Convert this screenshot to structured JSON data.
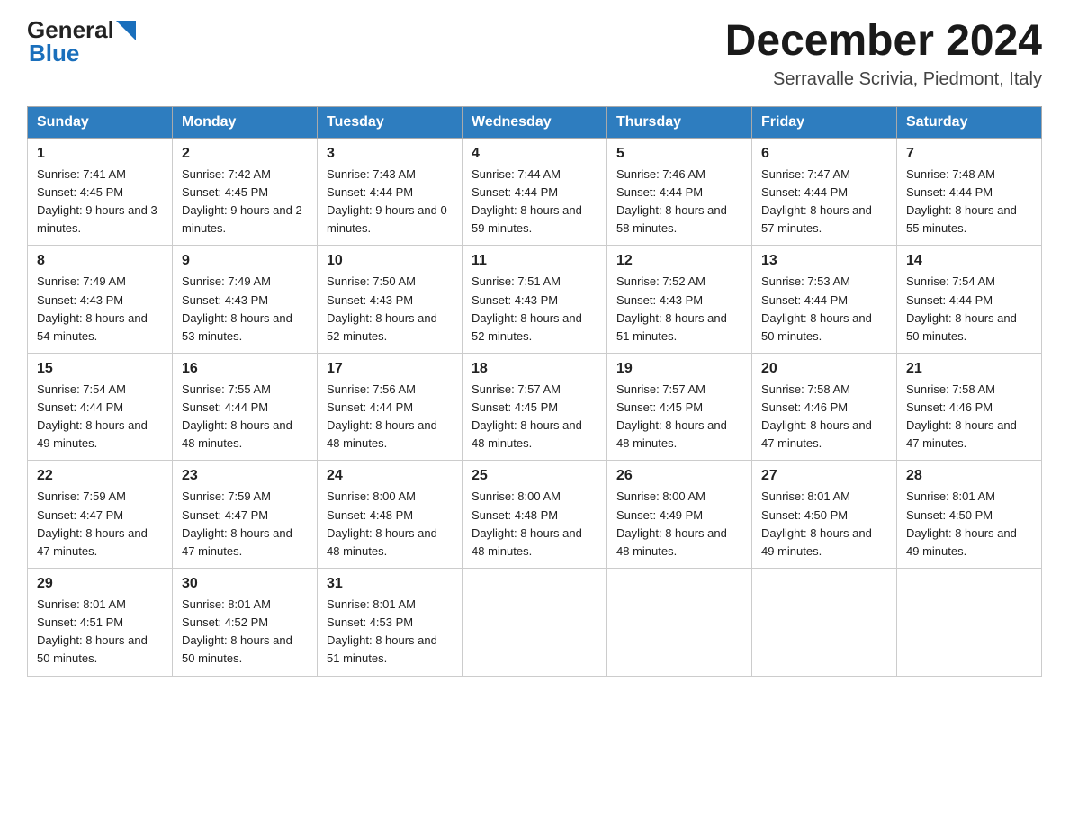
{
  "header": {
    "logo": {
      "general": "General",
      "blue": "Blue",
      "alt": "GeneralBlue logo"
    },
    "title": "December 2024",
    "subtitle": "Serravalle Scrivia, Piedmont, Italy"
  },
  "columns": [
    "Sunday",
    "Monday",
    "Tuesday",
    "Wednesday",
    "Thursday",
    "Friday",
    "Saturday"
  ],
  "weeks": [
    [
      {
        "day": "1",
        "sunrise": "7:41 AM",
        "sunset": "4:45 PM",
        "daylight": "9 hours and 3 minutes."
      },
      {
        "day": "2",
        "sunrise": "7:42 AM",
        "sunset": "4:45 PM",
        "daylight": "9 hours and 2 minutes."
      },
      {
        "day": "3",
        "sunrise": "7:43 AM",
        "sunset": "4:44 PM",
        "daylight": "9 hours and 0 minutes."
      },
      {
        "day": "4",
        "sunrise": "7:44 AM",
        "sunset": "4:44 PM",
        "daylight": "8 hours and 59 minutes."
      },
      {
        "day": "5",
        "sunrise": "7:46 AM",
        "sunset": "4:44 PM",
        "daylight": "8 hours and 58 minutes."
      },
      {
        "day": "6",
        "sunrise": "7:47 AM",
        "sunset": "4:44 PM",
        "daylight": "8 hours and 57 minutes."
      },
      {
        "day": "7",
        "sunrise": "7:48 AM",
        "sunset": "4:44 PM",
        "daylight": "8 hours and 55 minutes."
      }
    ],
    [
      {
        "day": "8",
        "sunrise": "7:49 AM",
        "sunset": "4:43 PM",
        "daylight": "8 hours and 54 minutes."
      },
      {
        "day": "9",
        "sunrise": "7:49 AM",
        "sunset": "4:43 PM",
        "daylight": "8 hours and 53 minutes."
      },
      {
        "day": "10",
        "sunrise": "7:50 AM",
        "sunset": "4:43 PM",
        "daylight": "8 hours and 52 minutes."
      },
      {
        "day": "11",
        "sunrise": "7:51 AM",
        "sunset": "4:43 PM",
        "daylight": "8 hours and 52 minutes."
      },
      {
        "day": "12",
        "sunrise": "7:52 AM",
        "sunset": "4:43 PM",
        "daylight": "8 hours and 51 minutes."
      },
      {
        "day": "13",
        "sunrise": "7:53 AM",
        "sunset": "4:44 PM",
        "daylight": "8 hours and 50 minutes."
      },
      {
        "day": "14",
        "sunrise": "7:54 AM",
        "sunset": "4:44 PM",
        "daylight": "8 hours and 50 minutes."
      }
    ],
    [
      {
        "day": "15",
        "sunrise": "7:54 AM",
        "sunset": "4:44 PM",
        "daylight": "8 hours and 49 minutes."
      },
      {
        "day": "16",
        "sunrise": "7:55 AM",
        "sunset": "4:44 PM",
        "daylight": "8 hours and 48 minutes."
      },
      {
        "day": "17",
        "sunrise": "7:56 AM",
        "sunset": "4:44 PM",
        "daylight": "8 hours and 48 minutes."
      },
      {
        "day": "18",
        "sunrise": "7:57 AM",
        "sunset": "4:45 PM",
        "daylight": "8 hours and 48 minutes."
      },
      {
        "day": "19",
        "sunrise": "7:57 AM",
        "sunset": "4:45 PM",
        "daylight": "8 hours and 48 minutes."
      },
      {
        "day": "20",
        "sunrise": "7:58 AM",
        "sunset": "4:46 PM",
        "daylight": "8 hours and 47 minutes."
      },
      {
        "day": "21",
        "sunrise": "7:58 AM",
        "sunset": "4:46 PM",
        "daylight": "8 hours and 47 minutes."
      }
    ],
    [
      {
        "day": "22",
        "sunrise": "7:59 AM",
        "sunset": "4:47 PM",
        "daylight": "8 hours and 47 minutes."
      },
      {
        "day": "23",
        "sunrise": "7:59 AM",
        "sunset": "4:47 PM",
        "daylight": "8 hours and 47 minutes."
      },
      {
        "day": "24",
        "sunrise": "8:00 AM",
        "sunset": "4:48 PM",
        "daylight": "8 hours and 48 minutes."
      },
      {
        "day": "25",
        "sunrise": "8:00 AM",
        "sunset": "4:48 PM",
        "daylight": "8 hours and 48 minutes."
      },
      {
        "day": "26",
        "sunrise": "8:00 AM",
        "sunset": "4:49 PM",
        "daylight": "8 hours and 48 minutes."
      },
      {
        "day": "27",
        "sunrise": "8:01 AM",
        "sunset": "4:50 PM",
        "daylight": "8 hours and 49 minutes."
      },
      {
        "day": "28",
        "sunrise": "8:01 AM",
        "sunset": "4:50 PM",
        "daylight": "8 hours and 49 minutes."
      }
    ],
    [
      {
        "day": "29",
        "sunrise": "8:01 AM",
        "sunset": "4:51 PM",
        "daylight": "8 hours and 50 minutes."
      },
      {
        "day": "30",
        "sunrise": "8:01 AM",
        "sunset": "4:52 PM",
        "daylight": "8 hours and 50 minutes."
      },
      {
        "day": "31",
        "sunrise": "8:01 AM",
        "sunset": "4:53 PM",
        "daylight": "8 hours and 51 minutes."
      },
      null,
      null,
      null,
      null
    ]
  ]
}
